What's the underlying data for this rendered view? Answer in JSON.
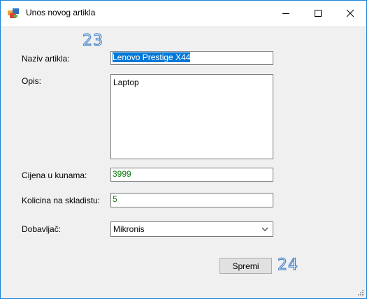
{
  "window": {
    "title": "Unos novog artikla"
  },
  "form": {
    "name_label": "Naziv artikla:",
    "name_value": "Lenovo Prestige X44",
    "desc_label": "Opis:",
    "desc_value": "Laptop",
    "price_label": "Cijena u kunama:",
    "price_value": "3999",
    "qty_label": "Kolicina na skladistu:",
    "qty_value": "5",
    "supplier_label": "Dobavljač:",
    "supplier_value": "Mikronis",
    "save_label": "Spremi"
  },
  "annotations": {
    "a": "23",
    "b": "24"
  },
  "colors": {
    "accent": "#0078d7",
    "value_text": "#107c10",
    "annotation": "#4a86c8"
  },
  "icons": [
    "app-icon",
    "minimize-icon",
    "maximize-icon",
    "close-icon",
    "chevron-down-icon",
    "resize-grip-icon"
  ]
}
